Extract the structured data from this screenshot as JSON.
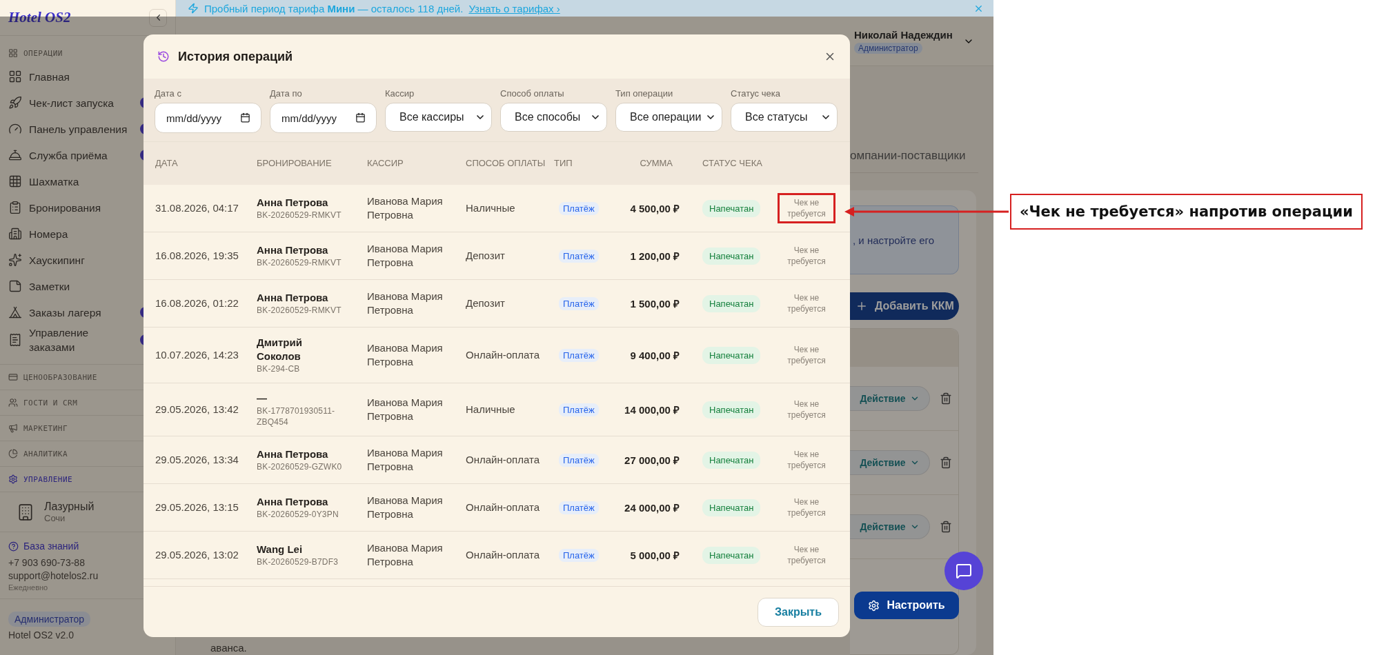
{
  "banner": {
    "text": "Пробный период тарифа **Мини** — осталось 118 дней.",
    "link": "Узнать о тарифах ›"
  },
  "sidebar": {
    "logo": "Hotel OS2",
    "group": {
      "title": "ОПЕРАЦИИ",
      "items": [
        {
          "label": "Главная",
          "badge": false
        },
        {
          "label": "Чек-лист запуска",
          "badge": true
        },
        {
          "label": "Панель управления",
          "badge": true
        },
        {
          "label": "Служба приёма",
          "badge": true
        },
        {
          "label": "Шахматка",
          "badge": false
        },
        {
          "label": "Бронирования",
          "badge": false
        },
        {
          "label": "Номера",
          "badge": false
        },
        {
          "label": "Хаускипинг",
          "badge": false
        },
        {
          "label": "Заметки",
          "badge": false
        },
        {
          "label": "Заказы лагеря",
          "badge": true
        },
        {
          "label": "Управление заказами",
          "badge": true
        }
      ]
    },
    "sections": [
      {
        "title": "ЦЕНООБРАЗОВАНИЕ",
        "selected": false
      },
      {
        "title": "ГОСТИ И CRM",
        "selected": false
      },
      {
        "title": "МАРКЕТИНГ",
        "selected": false
      },
      {
        "title": "АНАЛИТИКА",
        "selected": false
      },
      {
        "title": "УПРАВЛЕНИЕ",
        "selected": true
      }
    ],
    "property": {
      "name": "Лазурный",
      "city": "Сочи"
    },
    "support": {
      "link": "База знаний",
      "phone": "+7 903 690-73-88",
      "email": "support@hotelos2.ru",
      "hours": "Ежедневно"
    },
    "role": "Администратор",
    "version": "Hotel OS2 v2.0"
  },
  "user": {
    "name": "Николай Надеждин",
    "role": "Администратор"
  },
  "background": {
    "tab": "омпании-поставщики",
    "info_text": ", и настройте его",
    "add_button": "Добавить ККМ",
    "actions": [
      "Действие",
      "Действие",
      "Действие"
    ],
    "configure_button": "Настроить",
    "footnote": "аванса."
  },
  "modal": {
    "title": "История операций",
    "filters": [
      {
        "kind": "date",
        "label": "Дата с",
        "placeholder": "mm/dd/yyyy"
      },
      {
        "kind": "date",
        "label": "Дата по",
        "placeholder": "mm/dd/yyyy"
      },
      {
        "kind": "select",
        "label": "Кассир",
        "value": "Все кассиры"
      },
      {
        "kind": "select",
        "label": "Способ оплаты",
        "value": "Все способы"
      },
      {
        "kind": "select",
        "label": "Тип операции",
        "value": "Все операции"
      },
      {
        "kind": "select",
        "label": "Статус чека",
        "value": "Все статусы"
      }
    ],
    "columns": [
      "ДАТА",
      "БРОНИРОВАНИЕ",
      "КАССИР",
      "СПОСОБ ОПЛАТЫ",
      "ТИП",
      "СУММА",
      "СТАТУС ЧЕКА"
    ],
    "rows": [
      {
        "date": "31.08.2026, 04:17",
        "guest": "Анна Петрова",
        "booking": "BK-20260529-RMKVT",
        "cashier": "Иванова Мария Петровна",
        "method": "Наличные",
        "type": "Платёж",
        "amount": "4 500,00 ₽",
        "status": "Напечатан",
        "receipt": "Чек не требуется",
        "highlighted": true
      },
      {
        "date": "16.08.2026, 19:35",
        "guest": "Анна Петрова",
        "booking": "BK-20260529-RMKVT",
        "cashier": "Иванова Мария Петровна",
        "method": "Депозит",
        "type": "Платёж",
        "amount": "1 200,00 ₽",
        "status": "Напечатан",
        "receipt": "Чек не требуется",
        "highlighted": false
      },
      {
        "date": "16.08.2026, 01:22",
        "guest": "Анна Петрова",
        "booking": "BK-20260529-RMKVT",
        "cashier": "Иванова Мария Петровна",
        "method": "Депозит",
        "type": "Платёж",
        "amount": "1 500,00 ₽",
        "status": "Напечатан",
        "receipt": "Чек не требуется",
        "highlighted": false
      },
      {
        "date": "10.07.2026, 14:23",
        "guest": "Дмитрий Соколов",
        "booking": "BK-294-CB",
        "cashier": "Иванова Мария Петровна",
        "method": "Онлайн-оплата",
        "type": "Платёж",
        "amount": "9 400,00 ₽",
        "status": "Напечатан",
        "receipt": "Чек не требуется",
        "highlighted": false
      },
      {
        "date": "29.05.2026, 13:42",
        "guest": "—",
        "booking": "BK-1778701930511-ZBQ454",
        "cashier": "Иванова Мария Петровна",
        "method": "Наличные",
        "type": "Платёж",
        "amount": "14 000,00 ₽",
        "status": "Напечатан",
        "receipt": "Чек не требуется",
        "highlighted": false
      },
      {
        "date": "29.05.2026, 13:34",
        "guest": "Анна Петрова",
        "booking": "BK-20260529-GZWK0",
        "cashier": "Иванова Мария Петровна",
        "method": "Онлайн-оплата",
        "type": "Платёж",
        "amount": "27 000,00 ₽",
        "status": "Напечатан",
        "receipt": "Чек не требуется",
        "highlighted": false
      },
      {
        "date": "29.05.2026, 13:15",
        "guest": "Анна Петрова",
        "booking": "BK-20260529-0Y3PN",
        "cashier": "Иванова Мария Петровна",
        "method": "Онлайн-оплата",
        "type": "Платёж",
        "amount": "24 000,00 ₽",
        "status": "Напечатан",
        "receipt": "Чек не требуется",
        "highlighted": false
      },
      {
        "date": "29.05.2026, 13:02",
        "guest": "Wang Lei",
        "booking": "BK-20260529-B7DF3",
        "cashier": "Иванова Мария Петровна",
        "method": "Онлайн-оплата",
        "type": "Платёж",
        "amount": "5 000,00 ₽",
        "status": "Напечатан",
        "receipt": "Чек не требуется",
        "highlighted": false
      }
    ],
    "close_button": "Закрыть"
  },
  "annotation": {
    "text": "«Чек не требуется» напротив операции"
  }
}
